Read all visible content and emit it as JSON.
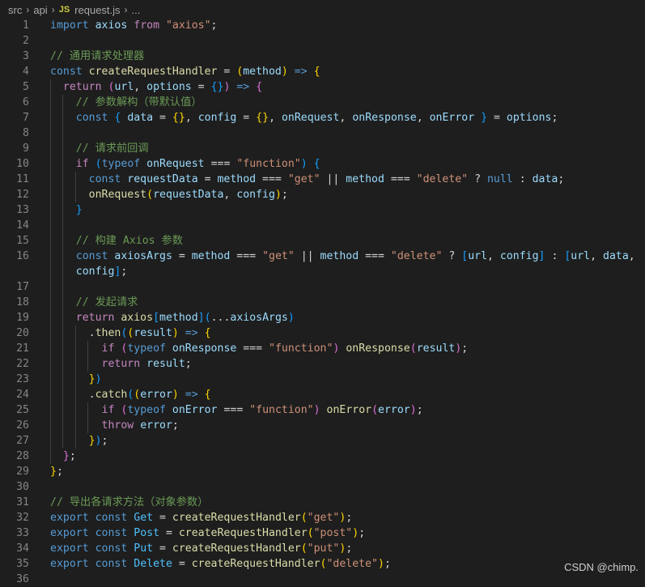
{
  "breadcrumb": {
    "items": [
      "src",
      "api",
      "request.js",
      "..."
    ],
    "file_type_badge": "JS",
    "separator": "›"
  },
  "code_lines": [
    {
      "n": "1",
      "indent": 0,
      "tokens": [
        [
          "kw",
          "import"
        ],
        [
          "pl",
          " "
        ],
        [
          "var",
          "axios"
        ],
        [
          "pl",
          " "
        ],
        [
          "ctl",
          "from"
        ],
        [
          "pl",
          " "
        ],
        [
          "str",
          "\"axios\""
        ],
        [
          "pl",
          ";"
        ]
      ]
    },
    {
      "n": "2",
      "indent": 0,
      "tokens": []
    },
    {
      "n": "3",
      "indent": 0,
      "tokens": [
        [
          "cm",
          "// 通用请求处理器"
        ]
      ]
    },
    {
      "n": "4",
      "indent": 0,
      "tokens": [
        [
          "kw",
          "const"
        ],
        [
          "pl",
          " "
        ],
        [
          "fn",
          "createRequestHandler"
        ],
        [
          "pl",
          " = "
        ],
        [
          "b1",
          "("
        ],
        [
          "var",
          "method"
        ],
        [
          "b1",
          ")"
        ],
        [
          "pl",
          " "
        ],
        [
          "kw",
          "=>"
        ],
        [
          "pl",
          " "
        ],
        [
          "b1",
          "{"
        ]
      ]
    },
    {
      "n": "5",
      "indent": 1,
      "tokens": [
        [
          "pl",
          "  "
        ],
        [
          "ctl",
          "return"
        ],
        [
          "pl",
          " "
        ],
        [
          "b2",
          "("
        ],
        [
          "var",
          "url"
        ],
        [
          "pl",
          ", "
        ],
        [
          "var",
          "options"
        ],
        [
          "pl",
          " = "
        ],
        [
          "b3",
          "{}"
        ],
        [
          "b2",
          ")"
        ],
        [
          "pl",
          " "
        ],
        [
          "kw",
          "=>"
        ],
        [
          "pl",
          " "
        ],
        [
          "b2",
          "{"
        ]
      ]
    },
    {
      "n": "6",
      "indent": 2,
      "tokens": [
        [
          "pl",
          "    "
        ],
        [
          "cm",
          "// 参数解构（带默认值）"
        ]
      ]
    },
    {
      "n": "7",
      "indent": 2,
      "tokens": [
        [
          "pl",
          "    "
        ],
        [
          "kw",
          "const"
        ],
        [
          "pl",
          " "
        ],
        [
          "b3",
          "{"
        ],
        [
          "pl",
          " "
        ],
        [
          "var",
          "data"
        ],
        [
          "pl",
          " = "
        ],
        [
          "b1",
          "{}"
        ],
        [
          "pl",
          ", "
        ],
        [
          "var",
          "config"
        ],
        [
          "pl",
          " = "
        ],
        [
          "b1",
          "{}"
        ],
        [
          "pl",
          ", "
        ],
        [
          "var",
          "onRequest"
        ],
        [
          "pl",
          ", "
        ],
        [
          "var",
          "onResponse"
        ],
        [
          "pl",
          ", "
        ],
        [
          "var",
          "onError"
        ],
        [
          "pl",
          " "
        ],
        [
          "b3",
          "}"
        ],
        [
          "pl",
          " = "
        ],
        [
          "var",
          "options"
        ],
        [
          "pl",
          ";"
        ]
      ]
    },
    {
      "n": "8",
      "indent": 2,
      "tokens": []
    },
    {
      "n": "9",
      "indent": 2,
      "tokens": [
        [
          "pl",
          "    "
        ],
        [
          "cm",
          "// 请求前回调"
        ]
      ]
    },
    {
      "n": "10",
      "indent": 2,
      "tokens": [
        [
          "pl",
          "    "
        ],
        [
          "ctl",
          "if"
        ],
        [
          "pl",
          " "
        ],
        [
          "b3",
          "("
        ],
        [
          "kw",
          "typeof"
        ],
        [
          "pl",
          " "
        ],
        [
          "var",
          "onRequest"
        ],
        [
          "pl",
          " === "
        ],
        [
          "str",
          "\"function\""
        ],
        [
          "b3",
          ")"
        ],
        [
          "pl",
          " "
        ],
        [
          "b3",
          "{"
        ]
      ]
    },
    {
      "n": "11",
      "indent": 3,
      "tokens": [
        [
          "pl",
          "      "
        ],
        [
          "kw",
          "const"
        ],
        [
          "pl",
          " "
        ],
        [
          "var",
          "requestData"
        ],
        [
          "pl",
          " = "
        ],
        [
          "var",
          "method"
        ],
        [
          "pl",
          " === "
        ],
        [
          "str",
          "\"get\""
        ],
        [
          "pl",
          " || "
        ],
        [
          "var",
          "method"
        ],
        [
          "pl",
          " === "
        ],
        [
          "str",
          "\"delete\""
        ],
        [
          "pl",
          " ? "
        ],
        [
          "kw",
          "null"
        ],
        [
          "pl",
          " : "
        ],
        [
          "var",
          "data"
        ],
        [
          "pl",
          ";"
        ]
      ]
    },
    {
      "n": "12",
      "indent": 3,
      "tokens": [
        [
          "pl",
          "      "
        ],
        [
          "fn",
          "onRequest"
        ],
        [
          "b1",
          "("
        ],
        [
          "var",
          "requestData"
        ],
        [
          "pl",
          ", "
        ],
        [
          "var",
          "config"
        ],
        [
          "b1",
          ")"
        ],
        [
          "pl",
          ";"
        ]
      ]
    },
    {
      "n": "13",
      "indent": 2,
      "tokens": [
        [
          "pl",
          "    "
        ],
        [
          "b3",
          "}"
        ]
      ]
    },
    {
      "n": "14",
      "indent": 2,
      "tokens": []
    },
    {
      "n": "15",
      "indent": 2,
      "tokens": [
        [
          "pl",
          "    "
        ],
        [
          "cm",
          "// 构建 Axios 参数"
        ]
      ]
    },
    {
      "n": "16",
      "indent": 2,
      "tokens": [
        [
          "pl",
          "    "
        ],
        [
          "kw",
          "const"
        ],
        [
          "pl",
          " "
        ],
        [
          "var",
          "axiosArgs"
        ],
        [
          "pl",
          " = "
        ],
        [
          "var",
          "method"
        ],
        [
          "pl",
          " === "
        ],
        [
          "str",
          "\"get\""
        ],
        [
          "pl",
          " || "
        ],
        [
          "var",
          "method"
        ],
        [
          "pl",
          " === "
        ],
        [
          "str",
          "\"delete\""
        ],
        [
          "pl",
          " ? "
        ],
        [
          "b3",
          "["
        ],
        [
          "var",
          "url"
        ],
        [
          "pl",
          ", "
        ],
        [
          "var",
          "config"
        ],
        [
          "b3",
          "]"
        ],
        [
          "pl",
          " : "
        ],
        [
          "b3",
          "["
        ],
        [
          "var",
          "url"
        ],
        [
          "pl",
          ", "
        ],
        [
          "var",
          "data"
        ],
        [
          "pl",
          ","
        ]
      ]
    },
    {
      "n": "",
      "indent": 2,
      "tokens": [
        [
          "pl",
          "    "
        ],
        [
          "var",
          "config"
        ],
        [
          "b3",
          "]"
        ],
        [
          "pl",
          ";"
        ]
      ]
    },
    {
      "n": "17",
      "indent": 2,
      "tokens": []
    },
    {
      "n": "18",
      "indent": 2,
      "tokens": [
        [
          "pl",
          "    "
        ],
        [
          "cm",
          "// 发起请求"
        ]
      ]
    },
    {
      "n": "19",
      "indent": 2,
      "tokens": [
        [
          "pl",
          "    "
        ],
        [
          "ctl",
          "return"
        ],
        [
          "pl",
          " "
        ],
        [
          "fn",
          "axios"
        ],
        [
          "b3",
          "["
        ],
        [
          "var",
          "method"
        ],
        [
          "b3",
          "]"
        ],
        [
          "b3",
          "("
        ],
        [
          "pl",
          "..."
        ],
        [
          "var",
          "axiosArgs"
        ],
        [
          "b3",
          ")"
        ]
      ]
    },
    {
      "n": "20",
      "indent": 3,
      "tokens": [
        [
          "pl",
          "      ."
        ],
        [
          "fn",
          "then"
        ],
        [
          "b3",
          "("
        ],
        [
          "b1",
          "("
        ],
        [
          "var",
          "result"
        ],
        [
          "b1",
          ")"
        ],
        [
          "pl",
          " "
        ],
        [
          "kw",
          "=>"
        ],
        [
          "pl",
          " "
        ],
        [
          "b1",
          "{"
        ]
      ]
    },
    {
      "n": "21",
      "indent": 4,
      "tokens": [
        [
          "pl",
          "        "
        ],
        [
          "ctl",
          "if"
        ],
        [
          "pl",
          " "
        ],
        [
          "b2",
          "("
        ],
        [
          "kw",
          "typeof"
        ],
        [
          "pl",
          " "
        ],
        [
          "var",
          "onResponse"
        ],
        [
          "pl",
          " === "
        ],
        [
          "str",
          "\"function\""
        ],
        [
          "b2",
          ")"
        ],
        [
          "pl",
          " "
        ],
        [
          "fn",
          "onResponse"
        ],
        [
          "b2",
          "("
        ],
        [
          "var",
          "result"
        ],
        [
          "b2",
          ")"
        ],
        [
          "pl",
          ";"
        ]
      ]
    },
    {
      "n": "22",
      "indent": 4,
      "tokens": [
        [
          "pl",
          "        "
        ],
        [
          "ctl",
          "return"
        ],
        [
          "pl",
          " "
        ],
        [
          "var",
          "result"
        ],
        [
          "pl",
          ";"
        ]
      ]
    },
    {
      "n": "23",
      "indent": 3,
      "tokens": [
        [
          "pl",
          "      "
        ],
        [
          "b1",
          "}"
        ],
        [
          "b3",
          ")"
        ]
      ]
    },
    {
      "n": "24",
      "indent": 3,
      "tokens": [
        [
          "pl",
          "      ."
        ],
        [
          "fn",
          "catch"
        ],
        [
          "b3",
          "("
        ],
        [
          "b1",
          "("
        ],
        [
          "var",
          "error"
        ],
        [
          "b1",
          ")"
        ],
        [
          "pl",
          " "
        ],
        [
          "kw",
          "=>"
        ],
        [
          "pl",
          " "
        ],
        [
          "b1",
          "{"
        ]
      ]
    },
    {
      "n": "25",
      "indent": 4,
      "tokens": [
        [
          "pl",
          "        "
        ],
        [
          "ctl",
          "if"
        ],
        [
          "pl",
          " "
        ],
        [
          "b2",
          "("
        ],
        [
          "kw",
          "typeof"
        ],
        [
          "pl",
          " "
        ],
        [
          "var",
          "onError"
        ],
        [
          "pl",
          " === "
        ],
        [
          "str",
          "\"function\""
        ],
        [
          "b2",
          ")"
        ],
        [
          "pl",
          " "
        ],
        [
          "fn",
          "onError"
        ],
        [
          "b2",
          "("
        ],
        [
          "var",
          "error"
        ],
        [
          "b2",
          ")"
        ],
        [
          "pl",
          ";"
        ]
      ]
    },
    {
      "n": "26",
      "indent": 4,
      "tokens": [
        [
          "pl",
          "        "
        ],
        [
          "ctl",
          "throw"
        ],
        [
          "pl",
          " "
        ],
        [
          "var",
          "error"
        ],
        [
          "pl",
          ";"
        ]
      ]
    },
    {
      "n": "27",
      "indent": 3,
      "tokens": [
        [
          "pl",
          "      "
        ],
        [
          "b1",
          "}"
        ],
        [
          "b3",
          ")"
        ],
        [
          "pl",
          ";"
        ]
      ]
    },
    {
      "n": "28",
      "indent": 1,
      "tokens": [
        [
          "pl",
          "  "
        ],
        [
          "b2",
          "}"
        ],
        [
          "pl",
          ";"
        ]
      ]
    },
    {
      "n": "29",
      "indent": 0,
      "tokens": [
        [
          "b1",
          "}"
        ],
        [
          "pl",
          ";"
        ]
      ]
    },
    {
      "n": "30",
      "indent": 0,
      "tokens": []
    },
    {
      "n": "31",
      "indent": 0,
      "tokens": [
        [
          "cm",
          "// 导出各请求方法（对象参数）"
        ]
      ]
    },
    {
      "n": "32",
      "indent": 0,
      "tokens": [
        [
          "kw",
          "export"
        ],
        [
          "pl",
          " "
        ],
        [
          "kw",
          "const"
        ],
        [
          "pl",
          " "
        ],
        [
          "cst",
          "Get"
        ],
        [
          "pl",
          " = "
        ],
        [
          "fn",
          "createRequestHandler"
        ],
        [
          "b1",
          "("
        ],
        [
          "str",
          "\"get\""
        ],
        [
          "b1",
          ")"
        ],
        [
          "pl",
          ";"
        ]
      ]
    },
    {
      "n": "33",
      "indent": 0,
      "tokens": [
        [
          "kw",
          "export"
        ],
        [
          "pl",
          " "
        ],
        [
          "kw",
          "const"
        ],
        [
          "pl",
          " "
        ],
        [
          "cst",
          "Post"
        ],
        [
          "pl",
          " = "
        ],
        [
          "fn",
          "createRequestHandler"
        ],
        [
          "b1",
          "("
        ],
        [
          "str",
          "\"post\""
        ],
        [
          "b1",
          ")"
        ],
        [
          "pl",
          ";"
        ]
      ]
    },
    {
      "n": "34",
      "indent": 0,
      "tokens": [
        [
          "kw",
          "export"
        ],
        [
          "pl",
          " "
        ],
        [
          "kw",
          "const"
        ],
        [
          "pl",
          " "
        ],
        [
          "cst",
          "Put"
        ],
        [
          "pl",
          " = "
        ],
        [
          "fn",
          "createRequestHandler"
        ],
        [
          "b1",
          "("
        ],
        [
          "str",
          "\"put\""
        ],
        [
          "b1",
          ")"
        ],
        [
          "pl",
          ";"
        ]
      ]
    },
    {
      "n": "35",
      "indent": 0,
      "tokens": [
        [
          "kw",
          "export"
        ],
        [
          "pl",
          " "
        ],
        [
          "kw",
          "const"
        ],
        [
          "pl",
          " "
        ],
        [
          "cst",
          "Delete"
        ],
        [
          "pl",
          " = "
        ],
        [
          "fn",
          "createRequestHandler"
        ],
        [
          "b1",
          "("
        ],
        [
          "str",
          "\"delete\""
        ],
        [
          "b1",
          ")"
        ],
        [
          "pl",
          ";"
        ]
      ]
    },
    {
      "n": "36",
      "indent": 0,
      "tokens": []
    }
  ],
  "watermark": "CSDN @chimp."
}
